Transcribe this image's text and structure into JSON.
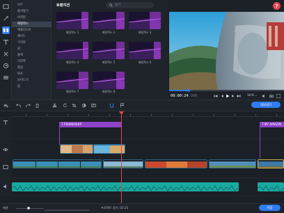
{
  "sidebar": {
    "tools": [
      {
        "icon": "media-files-icon"
      },
      {
        "icon": "filters-icon"
      },
      {
        "icon": "transitions-icon"
      },
      {
        "icon": "titles-icon"
      },
      {
        "icon": "stickers-icon"
      },
      {
        "icon": "clock-icon"
      },
      {
        "icon": "more-tools-icon"
      }
    ],
    "categories": [
      {
        "label": "모두",
        "selected": false
      },
      {
        "label": "즐겨찾기",
        "selected": false
      },
      {
        "label": "비치된",
        "selected": false
      },
      {
        "label": "패럴랙스",
        "selected": true
      },
      {
        "label": "애플리시프",
        "selected": false
      },
      {
        "label": "페이드",
        "selected": false
      },
      {
        "label": "크리야",
        "selected": false
      },
      {
        "label": "원",
        "selected": false
      },
      {
        "label": "플랙",
        "selected": false
      },
      {
        "label": "기하학",
        "selected": false
      },
      {
        "label": "팝업",
        "selected": false
      },
      {
        "label": "와프",
        "selected": false
      },
      {
        "label": "보이드기",
        "selected": false
      },
      {
        "label": "줌",
        "selected": false
      }
    ]
  },
  "library": {
    "title": "트랜지션",
    "search_placeholder": "찾기",
    "tiles": [
      {
        "label": "패럴랙스 1"
      },
      {
        "label": "패럴랙스 2"
      },
      {
        "label": "패럴랙스 3"
      },
      {
        "label": "패럴랙스 4"
      },
      {
        "label": "패럴랙스 5"
      },
      {
        "label": "패럴랙스 6"
      },
      {
        "label": "패럴랙스 7"
      },
      {
        "label": "패럴랙스 8"
      }
    ]
  },
  "player": {
    "help_label": "?",
    "timecode_main": "00:00:24",
    "timecode_ms": ".300",
    "aspect_ratio": "16:9 ⌄",
    "progress": 0.17
  },
  "toolbar": {
    "export_label": "내보내기"
  },
  "timeline": {
    "titles": [
      {
        "label": "FRIENDSHIP"
      },
      {
        "label": "MY AMAZIN"
      }
    ]
  },
  "status": {
    "zoom_label": "배율",
    "project_info": "프로젝트 길이: 02:25",
    "save_label": "저장"
  },
  "colors": {
    "accent": "#2f7bf0",
    "title_clip": "#8e44c9",
    "audio_clip": "#1aa9a0",
    "playhead": "#e5484d"
  }
}
